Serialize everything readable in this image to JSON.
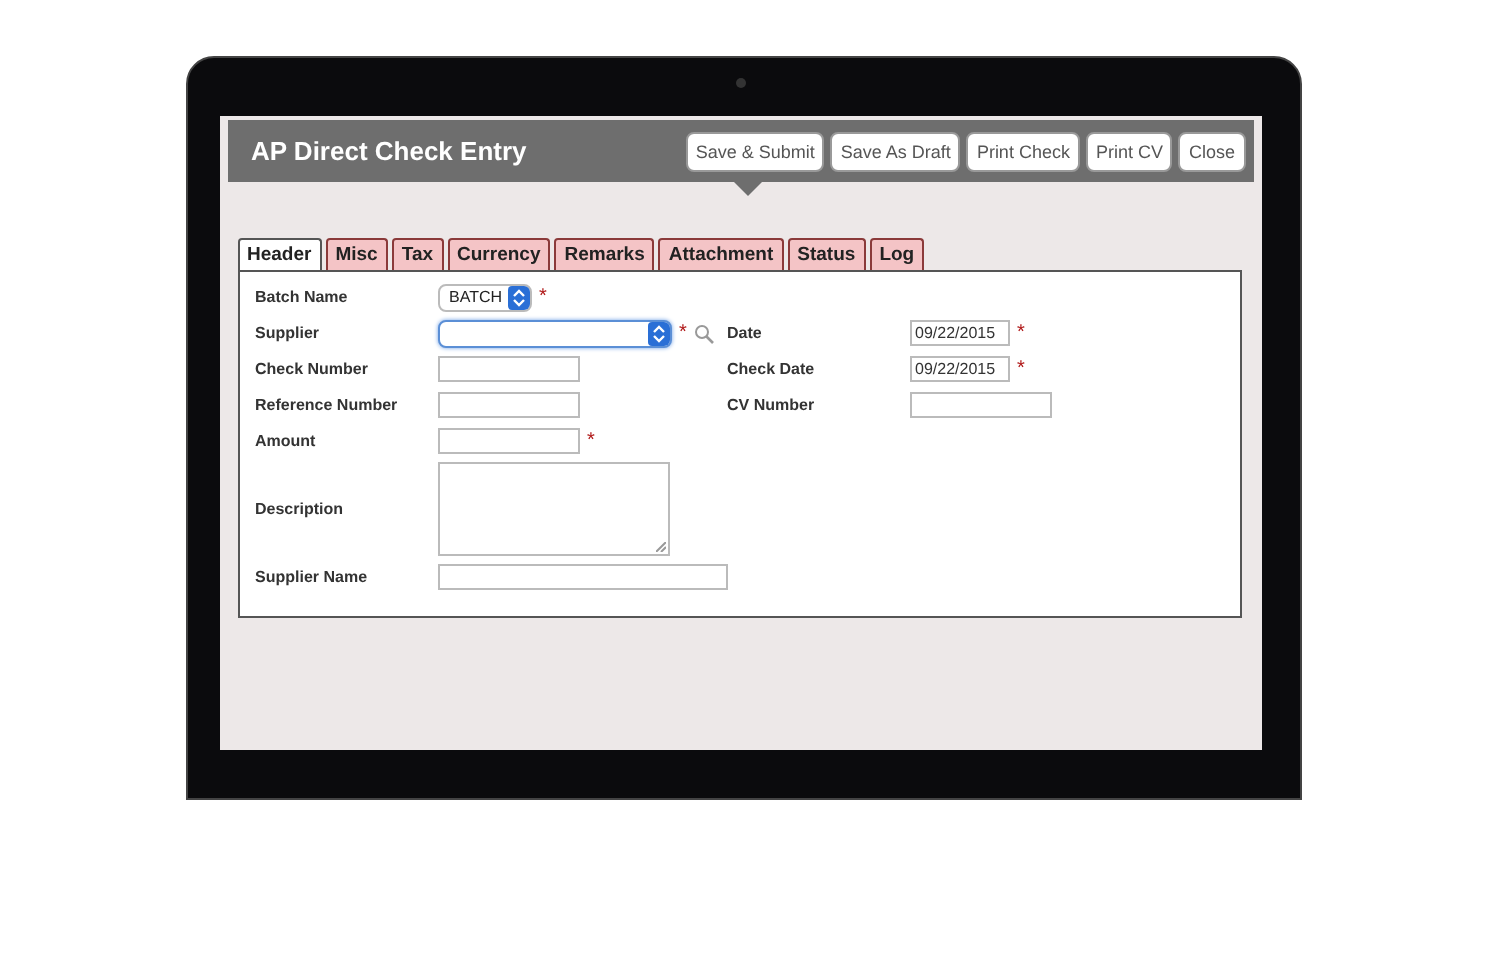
{
  "window": {
    "title": "AP Direct Check Entry"
  },
  "actions": [
    "Save & Submit",
    "Save As Draft",
    "Print Check",
    "Print CV",
    "Close"
  ],
  "tabs": [
    {
      "label": "Header",
      "selected": true
    },
    {
      "label": "Misc",
      "selected": false
    },
    {
      "label": "Tax",
      "selected": false
    },
    {
      "label": "Currency",
      "selected": false
    },
    {
      "label": "Remarks",
      "selected": false
    },
    {
      "label": "Attachment",
      "selected": false
    },
    {
      "label": "Status",
      "selected": false
    },
    {
      "label": "Log",
      "selected": false
    }
  ],
  "rows": [
    {
      "left": {
        "label": "Batch Name",
        "kind": "select",
        "value": "BATCH",
        "marker": "*",
        "focused": false
      }
    },
    {
      "left": {
        "label": "Supplier",
        "kind": "combo",
        "marker": "*",
        "focused": true,
        "search": true
      },
      "right": {
        "label": "Date",
        "kind": "date",
        "value": "09/22/2015",
        "marker": "*"
      }
    },
    {
      "left": {
        "label": "Check Number",
        "kind": "text"
      },
      "right": {
        "label": "Check Date",
        "kind": "date",
        "value": "09/22/2015",
        "marker": "*"
      }
    },
    {
      "left": {
        "label": "Reference Number",
        "kind": "text"
      },
      "right": {
        "label": "CV Number",
        "kind": "text"
      }
    },
    {
      "left": {
        "label": "Amount",
        "kind": "text",
        "marker": "*"
      }
    },
    {
      "left": {
        "label": "Description",
        "kind": "textarea"
      }
    },
    {
      "left": {
        "label": "Supplier Name",
        "kind": "wide"
      }
    }
  ]
}
